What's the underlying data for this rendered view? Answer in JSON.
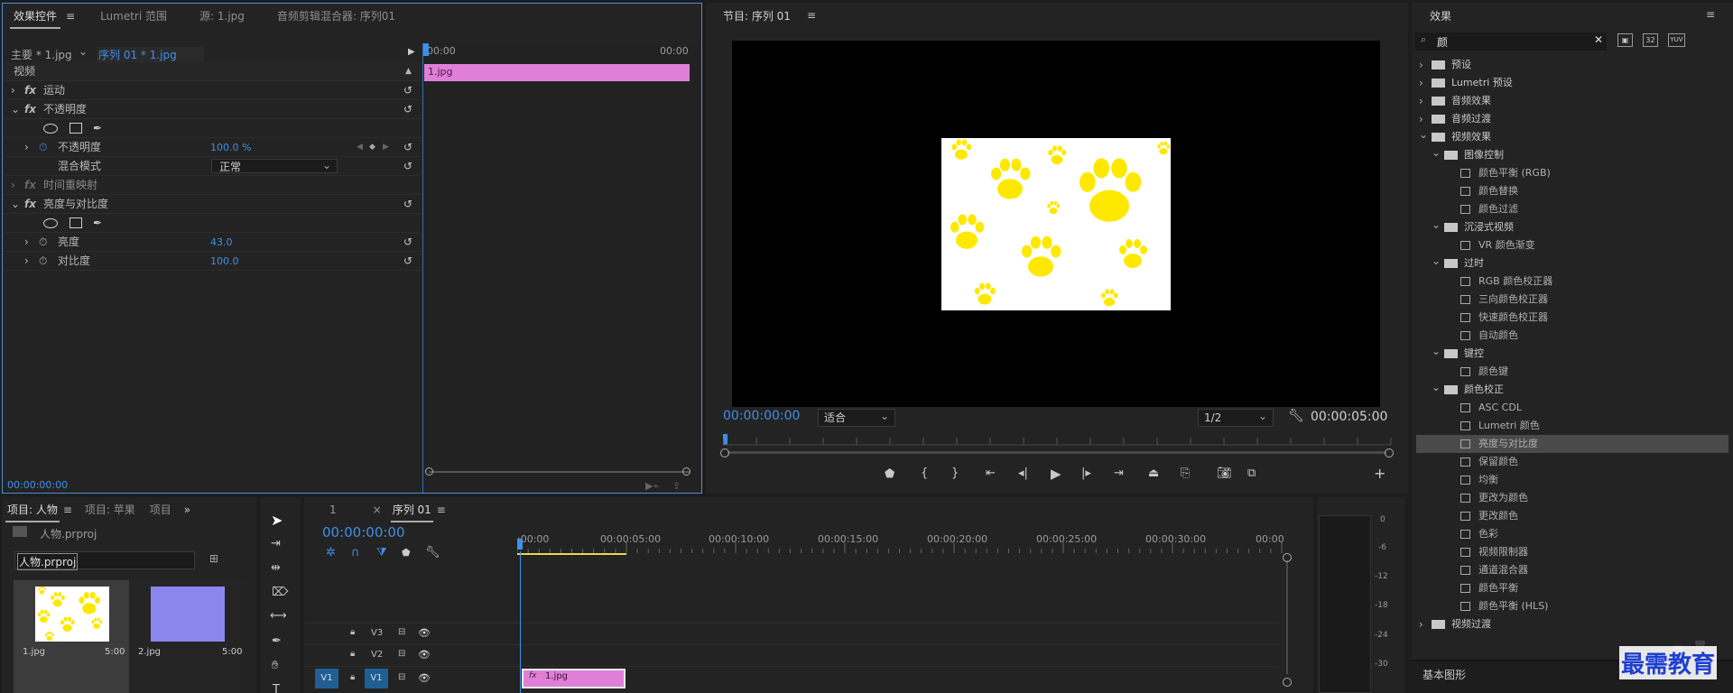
{
  "effect_controls": {
    "tabs": [
      "效果控件",
      "Lumetri 范围",
      "源: 1.jpg",
      "音频剪辑混合器: 序列01"
    ],
    "master_clip": "主要 * 1.jpg",
    "sequence_clip": "序列 01 * 1.jpg",
    "time_start": "00:00",
    "time_end": "00:00",
    "clip_name": "1.jpg",
    "section_video": "视频",
    "rows": {
      "motion": "运动",
      "opacity": "不透明度",
      "opacity_prop": "不透明度",
      "opacity_value": "100.0 %",
      "blend_mode": "混合模式",
      "blend_value": "正常",
      "time_remap": "时间重映射",
      "brightness_contrast": "亮度与对比度",
      "brightness": "亮度",
      "brightness_value": "43.0",
      "contrast": "对比度",
      "contrast_value": "100.0"
    },
    "timecode": "00:00:00:00",
    "fx_label": "fx"
  },
  "program_monitor": {
    "title": "节目: 序列 01",
    "timecode": "00:00:00:00",
    "fit": "适合",
    "quality": "1/2",
    "duration": "00:00:05:00"
  },
  "project": {
    "tabs": [
      "项目: 人物",
      "项目: 苹果",
      "项目"
    ],
    "file": "人物.prproj",
    "search_value": "人物.prproj",
    "items": [
      {
        "name": "1.jpg",
        "duration": "5:00"
      },
      {
        "name": "2.jpg",
        "duration": "5:00"
      }
    ],
    "thumb2_color": "#8b86ee"
  },
  "timeline": {
    "tabs": [
      "1",
      "序列 01"
    ],
    "close_glyph": "×",
    "timecode": "00:00:00:00",
    "ruler": [
      ":00:00",
      "00:00:05:00",
      "00:00:10:00",
      "00:00:15:00",
      "00:00:20:00",
      "00:00:25:00",
      "00:00:30:00",
      "00:00"
    ],
    "tracks": [
      "V3",
      "V2",
      "V1"
    ],
    "source_patch": "V1",
    "clip_label": "1.jpg",
    "clip_fx": "fx",
    "clip_color": "#e07fd8"
  },
  "meter": {
    "labels": [
      "0",
      "-6",
      "-12",
      "-18",
      "-24",
      "-30"
    ]
  },
  "effects": {
    "title": "效果",
    "search_value": "颜",
    "tree": [
      {
        "label": "预设",
        "level": 0,
        "type": "folder",
        "expanded": false
      },
      {
        "label": "Lumetri 预设",
        "level": 0,
        "type": "folder",
        "expanded": false
      },
      {
        "label": "音频效果",
        "level": 0,
        "type": "folder",
        "expanded": false
      },
      {
        "label": "音频过渡",
        "level": 0,
        "type": "folder",
        "expanded": false
      },
      {
        "label": "视频效果",
        "level": 0,
        "type": "folder",
        "expanded": true
      },
      {
        "label": "图像控制",
        "level": 1,
        "type": "folder",
        "expanded": true
      },
      {
        "label": "颜色平衡 (RGB)",
        "level": 2,
        "type": "effect"
      },
      {
        "label": "颜色替换",
        "level": 2,
        "type": "effect"
      },
      {
        "label": "颜色过滤",
        "level": 2,
        "type": "effect"
      },
      {
        "label": "沉浸式视频",
        "level": 1,
        "type": "folder",
        "expanded": true
      },
      {
        "label": "VR 颜色渐变",
        "level": 2,
        "type": "effect"
      },
      {
        "label": "过时",
        "level": 1,
        "type": "folder",
        "expanded": true
      },
      {
        "label": "RGB 颜色校正器",
        "level": 2,
        "type": "effect"
      },
      {
        "label": "三向颜色校正器",
        "level": 2,
        "type": "effect"
      },
      {
        "label": "快速颜色校正器",
        "level": 2,
        "type": "effect"
      },
      {
        "label": "自动颜色",
        "level": 2,
        "type": "effect"
      },
      {
        "label": "键控",
        "level": 1,
        "type": "folder",
        "expanded": true
      },
      {
        "label": "颜色键",
        "level": 2,
        "type": "effect"
      },
      {
        "label": "颜色校正",
        "level": 1,
        "type": "folder",
        "expanded": true
      },
      {
        "label": "ASC CDL",
        "level": 2,
        "type": "effect"
      },
      {
        "label": "Lumetri 颜色",
        "level": 2,
        "type": "effect"
      },
      {
        "label": "亮度与对比度",
        "level": 2,
        "type": "effect",
        "selected": true
      },
      {
        "label": "保留颜色",
        "level": 2,
        "type": "effect"
      },
      {
        "label": "均衡",
        "level": 2,
        "type": "effect"
      },
      {
        "label": "更改为颜色",
        "level": 2,
        "type": "effect"
      },
      {
        "label": "更改颜色",
        "level": 2,
        "type": "effect"
      },
      {
        "label": "色彩",
        "level": 2,
        "type": "effect"
      },
      {
        "label": "视频限制器",
        "level": 2,
        "type": "effect"
      },
      {
        "label": "通道混合器",
        "level": 2,
        "type": "effect"
      },
      {
        "label": "颜色平衡",
        "level": 2,
        "type": "effect"
      },
      {
        "label": "颜色平衡 (HLS)",
        "level": 2,
        "type": "effect"
      },
      {
        "label": "视频过渡",
        "level": 0,
        "type": "folder",
        "expanded": false
      }
    ],
    "bottom_panel": "基本图形",
    "badges": [
      "32",
      "YUV"
    ]
  },
  "watermark": "最需教育",
  "colors": {
    "accent": "#3f8fe6",
    "clip": "#e07fd8",
    "paw": "#ffe800",
    "watermark": "#1f3fd0"
  }
}
